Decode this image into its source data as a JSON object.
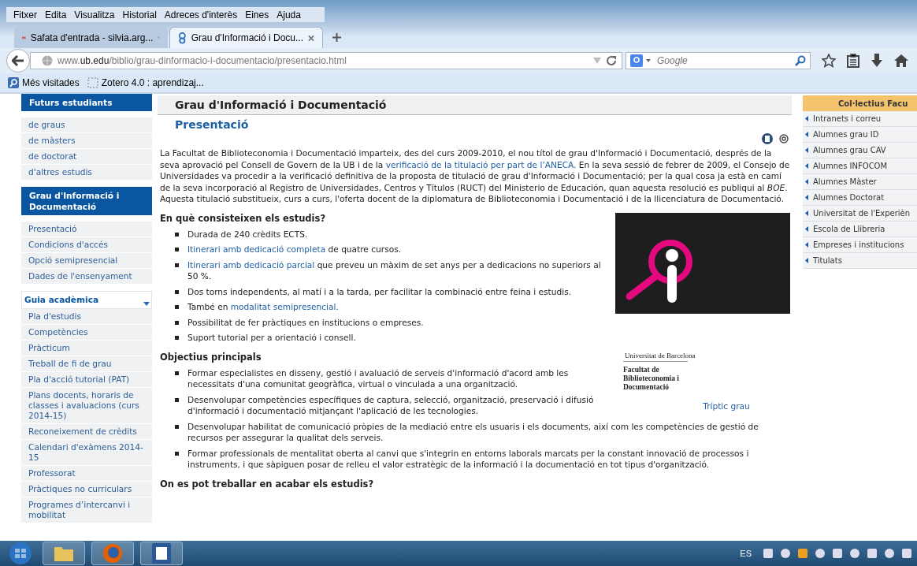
{
  "menu": [
    "Fitxer",
    "Edita",
    "Visualitza",
    "Historial",
    "Adreces d'interès",
    "Eines",
    "Ajuda"
  ],
  "tabs": [
    {
      "title": "Safata d'entrada - silvia.arg...",
      "kind": "mail",
      "selected": false
    },
    {
      "title": "Grau d'Informació i Docu...",
      "kind": "site",
      "selected": true
    }
  ],
  "address": {
    "prefix": "www.",
    "host": "ub.edu",
    "path": "/biblio/grau-dinformacio-i-documentacio/presentacio.html"
  },
  "search": {
    "placeholder": "Google"
  },
  "bookmarks": [
    {
      "label": "Més visitades",
      "kind": "folder"
    },
    {
      "label": "Zotero 4.0 : aprendizaj...",
      "kind": "page"
    }
  ],
  "sidebar": [
    {
      "title": "Futurs estudiants",
      "kind": "header",
      "items": [
        "de graus",
        "de màsters",
        "de doctorat",
        "d'altres estudis"
      ]
    },
    {
      "title": "Grau d'Informació i Documentació",
      "kind": "header",
      "items": [
        "Presentació",
        "Condicions d'accés",
        "Opció semipresencial",
        "Dades de l'ensenyament"
      ]
    },
    {
      "title": "Guia acadèmica",
      "kind": "subheader",
      "items": [
        "Pla d'estudis",
        "Competències",
        "Pràcticum",
        "Treball de fi de grau",
        "Pla d'acció tutorial (PAT)",
        "Plans docents, horaris de classes i avaluacions (curs 2014-15)",
        "Reconeixement de crèdits",
        "Calendari d'exàmens 2014-15",
        "Professorat",
        "Pràctiques no curriculars",
        "Programes d’intercanvi i mobilitat"
      ]
    }
  ],
  "content": {
    "title": "Grau d'Informació i Documentació",
    "subtitle": "Presentació",
    "intro": [
      {
        "kind": "text",
        "text": "La Facultat de Biblioteconomia i Documentació imparteix, des del curs 2009-2010, el nou títol de grau d'Informació i Documentació, després de la seva aprovació pel Consell de Govern de la UB i de la "
      },
      {
        "kind": "link",
        "text": "verificació de la titulació per part de l’ANECA"
      },
      {
        "kind": "text",
        "text": ". En la seva sessió de febrer de 2009, el Consejo de Universidades va procedir a la verificació definitiva de la proposta de titulació de grau d'Informació i Documentació; per la qual cosa ja està en camí de la seva incorporació al Registro de Universidades, Centros y Títulos (RUCT) del Ministerio de Educación, quan aquesta resolució es publiqui al "
      },
      {
        "kind": "italic",
        "text": "BOE"
      },
      {
        "kind": "text",
        "text": ". Aquesta titulació substitueix, curs a curs, l'oferta docent de la diplomatura de Biblioteconomia i Documentació i de la llicenciatura de Documentació."
      }
    ],
    "sections": [
      {
        "heading": "En què consisteixen els estudis?",
        "items": [
          [
            {
              "kind": "text",
              "text": "Durada de 240 crèdits ECTS."
            }
          ],
          [
            {
              "kind": "link",
              "text": "Itinerari amb dedicació completa"
            },
            {
              "kind": "text",
              "text": " de quatre cursos."
            }
          ],
          [
            {
              "kind": "link",
              "text": "Itinerari amb dedicació parcial"
            },
            {
              "kind": "text",
              "text": " que preveu un màxim de set anys per a dedicacions no superiors al 50 %."
            }
          ],
          [
            {
              "kind": "text",
              "text": "Dos torns independents, al matí i a la tarda, per facilitar la combinació entre feina i estudis."
            }
          ],
          [
            {
              "kind": "text",
              "text": "També en "
            },
            {
              "kind": "link",
              "text": "modalitat semipresencial"
            },
            {
              "kind": "text",
              "text": "."
            }
          ],
          [
            {
              "kind": "text",
              "text": "Possibilitat de fer pràctiques en institucions o empreses."
            }
          ],
          [
            {
              "kind": "text",
              "text": "Suport tutorial per a orientació i consell."
            }
          ]
        ]
      },
      {
        "heading": "Objectius principals",
        "items": [
          [
            {
              "kind": "text",
              "text": "Formar especialistes en disseny, gestió i avaluació de serveis d'informació d'acord amb les necessitats d'una comunitat geogràfica, virtual o vinculada a una organització."
            }
          ],
          [
            {
              "kind": "text",
              "text": "Desenvolupar competències específiques de captura, selecció, organització, preservació i difusió d'informació i documentació mitjançant l'aplicació de les tecnologies."
            }
          ],
          [
            {
              "kind": "text",
              "text": "Desenvolupar habilitat de comunicació pròpies de la mediació entre els usuaris i els documents, així com les competències de gestió de recursos per assegurar la qualitat dels serveis."
            }
          ],
          [
            {
              "kind": "text",
              "text": "Formar professionals de mentalitat oberta al canvi que s'integrin en entorns laborals marcats per la constant innovació de processos i instruments, i que sàpiguen posar de relleu el valor estratègic de la informació i la documentació en tot tipus d'organització."
            }
          ]
        ]
      },
      {
        "heading": "On es pot treballar en acabar els estudis?"
      }
    ],
    "figure": {
      "university": "Universitat de Barcelona",
      "faculty": "Facultat de Biblioteconomia i Documentació",
      "link": "Tríptic grau"
    }
  },
  "right_panel": {
    "title": "Col·lectius Facu",
    "items": [
      "Intranets i correu",
      "Alumnes grau ID",
      "Alumnes grau CAV",
      "Alumnes INFOCOM",
      "Alumnes Màster",
      "Alumnes Doctorat",
      "Universitat de l'Experièn",
      "Escola de Llibreria",
      "Empreses i institucions",
      "Titulats"
    ]
  },
  "taskbar": {
    "language": "ES"
  }
}
